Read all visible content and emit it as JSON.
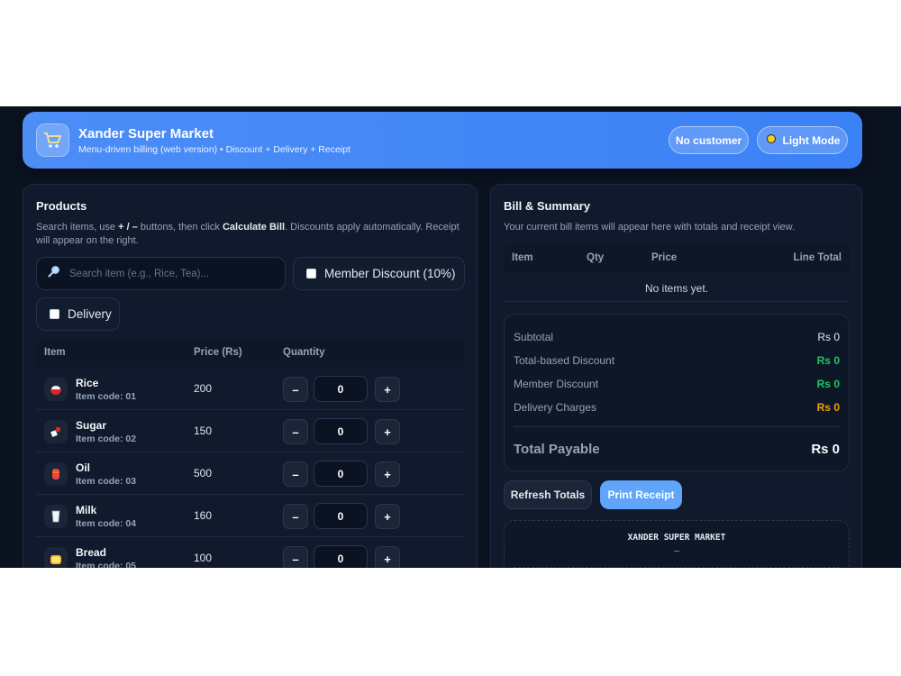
{
  "header": {
    "title": "Xander Super Market",
    "subtitle": "Menu-driven billing (web version) • Discount + Delivery + Receipt",
    "customer_label": "No customer",
    "theme_label": "Light Mode"
  },
  "products": {
    "title": "Products",
    "help_prefix": "Search items, use ",
    "help_buttons": "+ / –",
    "help_mid": " buttons, then click ",
    "help_action": "Calculate Bill",
    "help_suffix": ". Discounts apply automatically. Receipt will appear on the right.",
    "search_placeholder": "Search item (e.g., Rice, Tea)...",
    "member_discount_label": "Member Discount (10%)",
    "delivery_label": "Delivery",
    "columns": {
      "item": "Item",
      "price": "Price (Rs)",
      "quantity": "Quantity"
    },
    "rows": [
      {
        "name": "Rice",
        "code": "Item code: 01",
        "price": "200",
        "qty": "0",
        "icon": "rice-bowl-icon"
      },
      {
        "name": "Sugar",
        "code": "Item code: 02",
        "price": "150",
        "qty": "0",
        "icon": "sugar-icon"
      },
      {
        "name": "Oil",
        "code": "Item code: 03",
        "price": "500",
        "qty": "0",
        "icon": "oil-can-icon"
      },
      {
        "name": "Milk",
        "code": "Item code: 04",
        "price": "160",
        "qty": "0",
        "icon": "milk-glass-icon"
      },
      {
        "name": "Bread",
        "code": "Item code: 05",
        "price": "100",
        "qty": "0",
        "icon": "bread-icon"
      }
    ],
    "minus_label": "–",
    "plus_label": "+"
  },
  "bill": {
    "title": "Bill & Summary",
    "subtitle": "Your current bill items will appear here with totals and receipt view.",
    "columns": {
      "item": "Item",
      "qty": "Qty",
      "price": "Price",
      "line_total": "Line Total"
    },
    "empty": "No items yet.",
    "summary": {
      "subtotal_label": "Subtotal",
      "subtotal": "Rs 0",
      "total_discount_label": "Total-based Discount",
      "total_discount": "Rs 0",
      "member_discount_label": "Member Discount",
      "member_discount": "Rs 0",
      "delivery_label": "Delivery Charges",
      "delivery": "Rs 0",
      "payable_label": "Total Payable",
      "payable": "Rs 0"
    },
    "refresh_label": "Refresh Totals",
    "print_label": "Print Receipt",
    "receipt_title": "XANDER SUPER MARKET",
    "receipt_sub": "–"
  },
  "colors": {
    "accent": "#3b82f6",
    "positive": "#22c55e",
    "warning": "#f59e0b",
    "background": "#0b1220",
    "card": "#111a2c"
  }
}
